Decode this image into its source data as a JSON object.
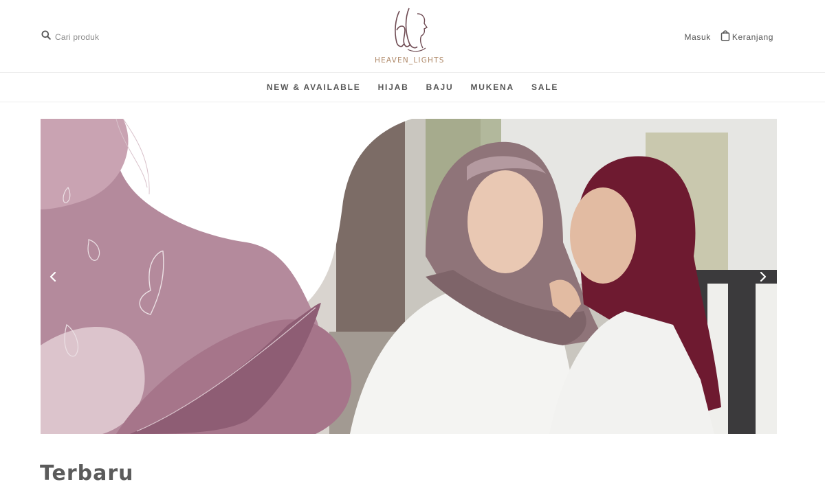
{
  "header": {
    "search_placeholder": "Cari produk",
    "logo_text": "HEAVEN_LIGHTS",
    "login_label": "Masuk",
    "cart_label": "Keranjang"
  },
  "nav": {
    "items": [
      {
        "label": "NEW & AVAILABLE"
      },
      {
        "label": "HIJAB"
      },
      {
        "label": "BAJU"
      },
      {
        "label": "MUKENA"
      },
      {
        "label": "SALE"
      }
    ]
  },
  "hero": {
    "prev_icon": "chevron-left-icon",
    "next_icon": "chevron-right-icon"
  },
  "section": {
    "title": "Terbaru"
  },
  "colors": {
    "text": "#555555",
    "brand": "#b08a6a",
    "logo_mark": "#6e4a52",
    "mauve": "#b48a9c",
    "plum": "#7a1c34"
  }
}
